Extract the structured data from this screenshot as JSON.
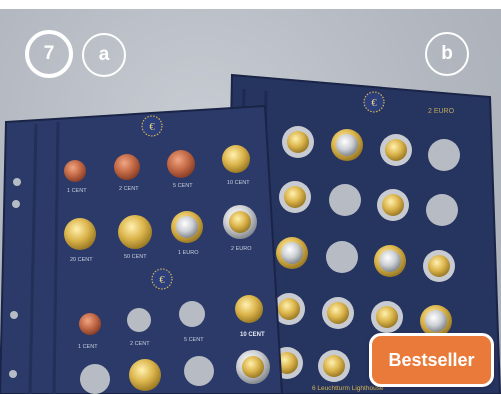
{
  "badges": {
    "number": "7",
    "left_label": "a",
    "right_label": "b"
  },
  "bestseller_label": "Bestseller",
  "left_sheet": {
    "row1_labels": [
      "1 CENT",
      "2 CENT",
      "5 CENT",
      "10 CENT"
    ],
    "row2_labels": [
      "20 CENT",
      "50 CENT",
      "1 EURO",
      "2 EURO"
    ],
    "row3_labels": [
      "1 CENT",
      "2 CENT",
      "5 CENT",
      "10 CENT"
    ]
  },
  "right_sheet": {
    "header_label": "2 EURO",
    "footer_label": "6 Leuchtturm Lighthouse"
  },
  "colors": {
    "sheet_navy": "#283763",
    "badge_orange": "#ea7a3a",
    "background_gray": "#b7bcc4"
  }
}
